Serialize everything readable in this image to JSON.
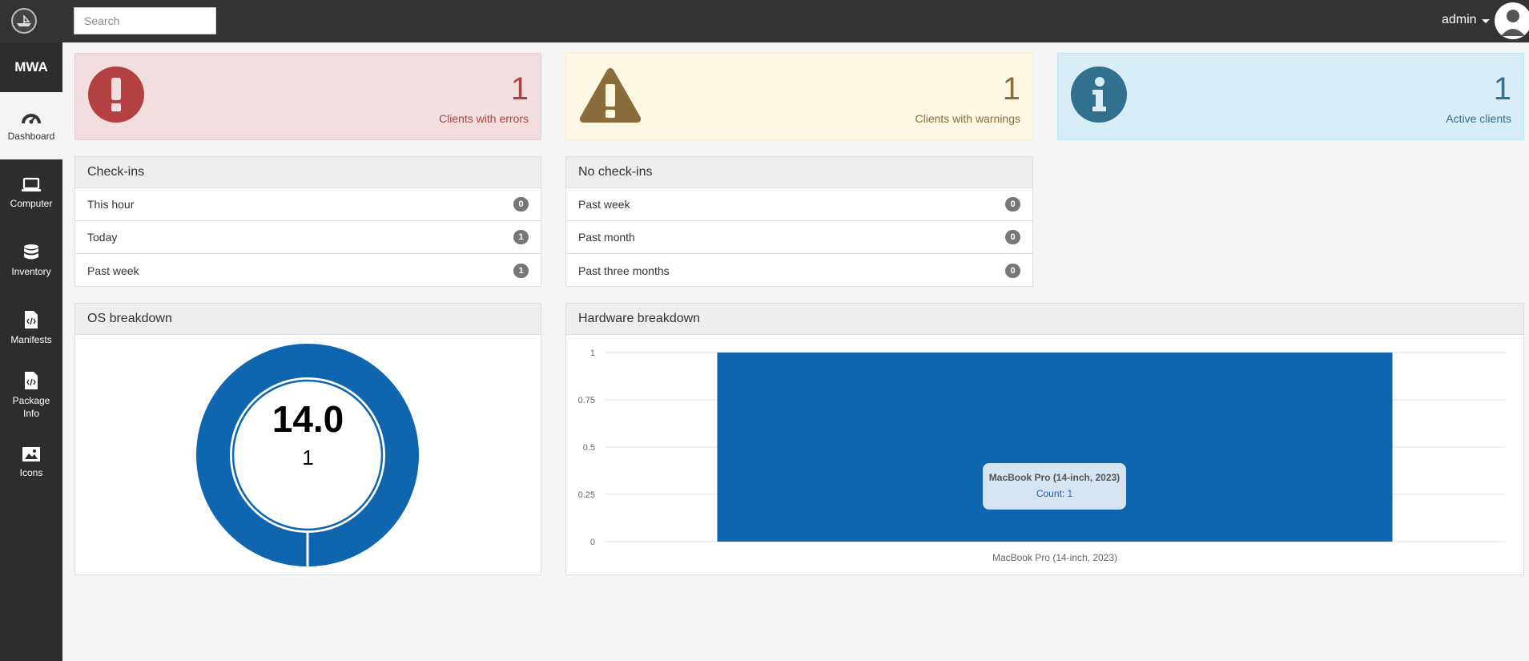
{
  "topbar": {
    "search_placeholder": "Search",
    "user_label": "admin"
  },
  "sidebar": {
    "brand": "MWA",
    "items": [
      {
        "label": "Dashboard",
        "icon": "dashboard-gauge-icon",
        "active": true
      },
      {
        "label": "Computer",
        "icon": "laptop-icon"
      },
      {
        "label": "Inventory",
        "icon": "database-icon"
      },
      {
        "label": "Manifests",
        "icon": "file-code-icon"
      },
      {
        "label": "Package Info",
        "icon": "file-code-icon"
      },
      {
        "label": "Icons",
        "icon": "image-icon"
      }
    ]
  },
  "alerts": {
    "errors": {
      "count": "1",
      "label": "Clients with errors",
      "icon": "exclamation-circle-icon",
      "color": "#b34141"
    },
    "warnings": {
      "count": "1",
      "label": "Clients with warnings",
      "icon": "warning-triangle-icon",
      "color": "#8a6d3b"
    },
    "active": {
      "count": "1",
      "label": "Active clients",
      "icon": "info-circle-icon",
      "color": "#31708f"
    }
  },
  "checkins": {
    "title": "Check-ins",
    "rows": [
      {
        "label": "This hour",
        "count": "0"
      },
      {
        "label": "Today",
        "count": "1"
      },
      {
        "label": "Past week",
        "count": "1"
      }
    ]
  },
  "no_checkins": {
    "title": "No check-ins",
    "rows": [
      {
        "label": "Past week",
        "count": "0"
      },
      {
        "label": "Past month",
        "count": "0"
      },
      {
        "label": "Past three months",
        "count": "0"
      }
    ]
  },
  "os_breakdown": {
    "title": "OS breakdown",
    "center_version": "14.0",
    "center_count": "1",
    "color": "#0f65ae"
  },
  "hardware_breakdown": {
    "title": "Hardware breakdown",
    "tooltip": {
      "title": "MacBook Pro (14-inch, 2023)",
      "value": "Count: 1"
    }
  },
  "chart_data": [
    {
      "type": "pie",
      "title": "OS breakdown",
      "categories": [
        "14.0"
      ],
      "values": [
        1
      ]
    },
    {
      "type": "bar",
      "title": "Hardware breakdown",
      "categories": [
        "MacBook Pro (14-inch, 2023)"
      ],
      "values": [
        1
      ],
      "ylim": [
        0,
        1
      ],
      "yticks": [
        "0",
        "0.25",
        "0.5",
        "0.75",
        "1"
      ],
      "grid": true,
      "color": "#0f65ae"
    }
  ]
}
